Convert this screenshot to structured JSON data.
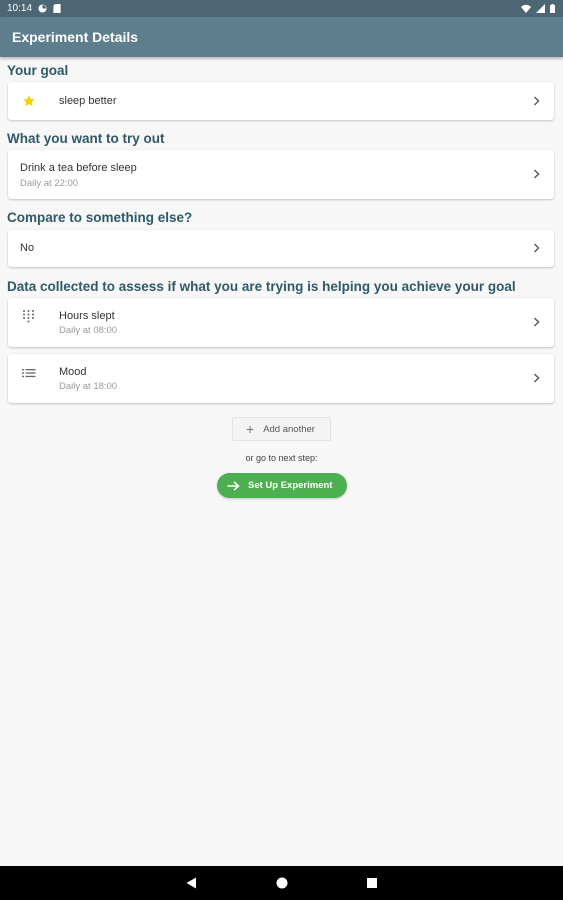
{
  "status_bar": {
    "time": "10:14"
  },
  "app_bar": {
    "title": "Experiment Details"
  },
  "sections": {
    "goal": {
      "title": "Your goal",
      "item": {
        "label": "sleep better",
        "icon": "star-icon"
      }
    },
    "try_out": {
      "title": "What you want to try out",
      "item": {
        "label": "Drink a tea before sleep",
        "sub": "Daily at 22:00"
      }
    },
    "compare": {
      "title": "Compare to something else?",
      "item": {
        "label": "No"
      }
    },
    "data": {
      "title": "Data collected to assess if what you are trying is helping you achieve your goal",
      "items": [
        {
          "label": "Hours slept",
          "sub": "Daily at 08:00",
          "icon": "dial-pad-icon"
        },
        {
          "label": "Mood",
          "sub": "Daily at 18:00",
          "icon": "list-icon"
        }
      ]
    }
  },
  "actions": {
    "add_another": "Add another",
    "next_step_text": "or go to next step:",
    "setup_label": "Set Up Experiment"
  },
  "colors": {
    "status_bar": "#4d6674",
    "app_bar": "#5e7e8d",
    "section_title": "#2f5968",
    "primary_button": "#4caf50",
    "star": "#f5d000"
  }
}
